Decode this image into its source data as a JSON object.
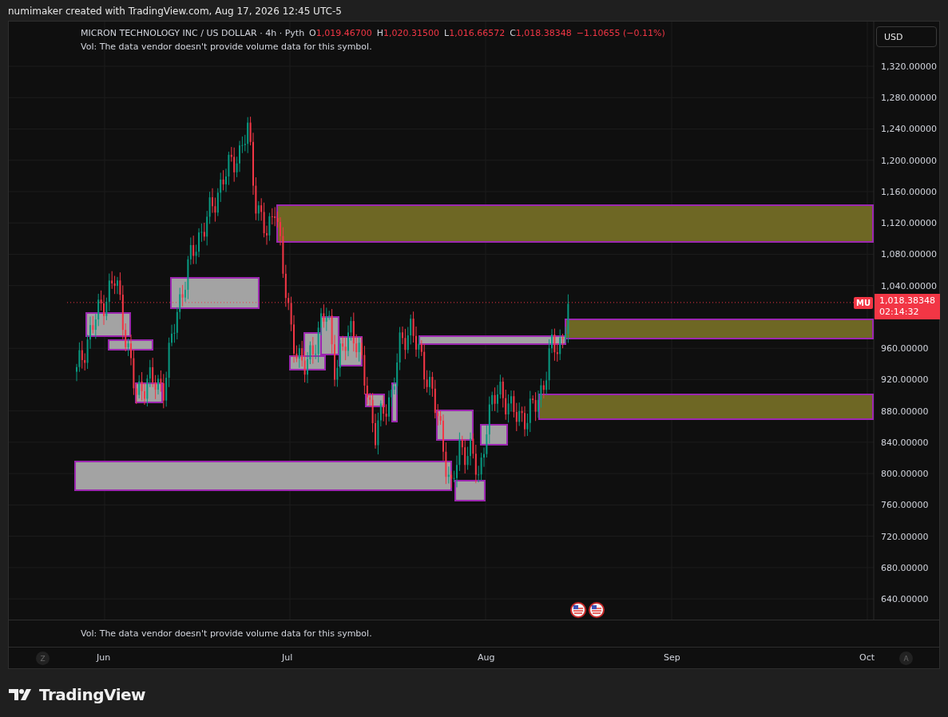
{
  "attribution": "numimaker created with TradingView.com, Aug 17, 2026 12:45 UTC-5",
  "legend": {
    "title": "MICRON TECHNOLOGY INC / US DOLLAR · 4h · Pyth",
    "ohlc": [
      {
        "label": "O",
        "value": "1,019.46700"
      },
      {
        "label": "H",
        "value": "1,020.31500"
      },
      {
        "label": "L",
        "value": "1,016.66572"
      },
      {
        "label": "C",
        "value": "1,018.38348"
      }
    ],
    "change": "−1.10655 (−0.11%)",
    "volume_note": "Vol: The data vendor doesn't provide volume data for this symbol."
  },
  "currency_button": "USD",
  "price_axis": {
    "ticks": [
      "1,320.00000",
      "1,280.00000",
      "1,240.00000",
      "1,200.00000",
      "1,160.00000",
      "1,120.00000",
      "1,080.00000",
      "1,040.00000",
      "960.00000",
      "920.00000",
      "880.00000",
      "840.00000",
      "800.00000",
      "760.00000",
      "720.00000",
      "680.00000",
      "640.00000"
    ]
  },
  "last_price": {
    "symbol": "MU",
    "price": "1,018.38348",
    "countdown": "02:14:32"
  },
  "volume_pane": {
    "note": "Vol: The data vendor doesn't provide volume data for this symbol."
  },
  "time_axis": {
    "labels": [
      "Jun",
      "Jul",
      "Aug",
      "Sep",
      "Oct"
    ],
    "left_button": "Z",
    "right_button": "A"
  },
  "logo": "TradingView"
}
